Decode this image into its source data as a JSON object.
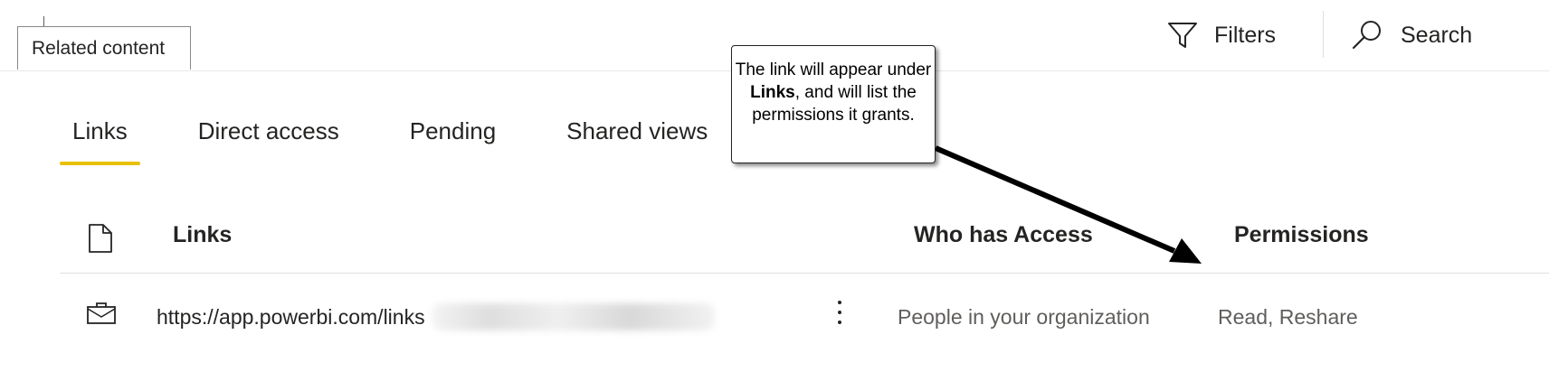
{
  "header": {
    "related_content_tab": "Related content",
    "filters_label": "Filters",
    "search_label": "Search"
  },
  "tabs": [
    {
      "label": "Links",
      "active": true
    },
    {
      "label": "Direct access",
      "active": false
    },
    {
      "label": "Pending",
      "active": false
    },
    {
      "label": "Shared views",
      "active": false
    }
  ],
  "table": {
    "columns": {
      "icon": "document-icon",
      "links": "Links",
      "who_has_access": "Who has Access",
      "permissions": "Permissions"
    },
    "rows": [
      {
        "icon": "briefcase-icon",
        "link": "https://app.powerbi.com/links",
        "who_has_access": "People in your organization",
        "permissions": "Read, Reshare"
      }
    ]
  },
  "callout": {
    "part1": "The link will appear under ",
    "bold": "Links",
    "part2": ", and will list the permissions it grants."
  },
  "colors": {
    "active_tab_underline": "#e8c000",
    "text_primary": "#252423",
    "text_secondary": "#605e5c"
  }
}
